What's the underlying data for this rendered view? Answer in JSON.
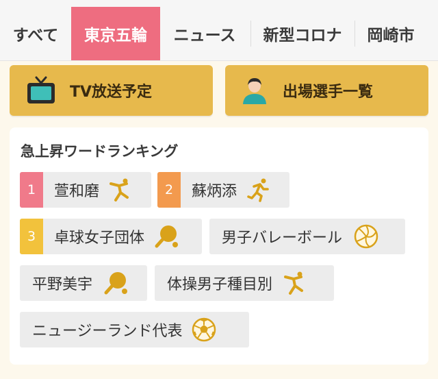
{
  "tabs": [
    {
      "label": "すべて",
      "active": false
    },
    {
      "label": "東京五輪",
      "active": true
    },
    {
      "label": "ニュース",
      "active": false
    },
    {
      "label": "新型コロナ",
      "active": false
    },
    {
      "label": "岡崎市",
      "active": false
    }
  ],
  "buttons": {
    "tv_label": "TV放送予定",
    "athletes_label": "出場選手一覧"
  },
  "ranking": {
    "title": "急上昇ワードランキング",
    "items": [
      {
        "rank": "1",
        "label": "萱和磨",
        "icon": "gymnastics-icon"
      },
      {
        "rank": "2",
        "label": "蘇炳添",
        "icon": "running-icon"
      },
      {
        "rank": "3",
        "label": "卓球女子団体",
        "icon": "table-tennis-icon"
      },
      {
        "rank": "",
        "label": "男子バレーボール",
        "icon": "volleyball-icon"
      },
      {
        "rank": "",
        "label": "平野美宇",
        "icon": "table-tennis-icon"
      },
      {
        "rank": "",
        "label": "体操男子種目別",
        "icon": "gymnastics-icon"
      },
      {
        "rank": "",
        "label": "ニュージーランド代表",
        "icon": "soccer-ball-icon"
      }
    ]
  },
  "colors": {
    "accent_tab": "#ee6d80",
    "button_bg": "#e7b94c",
    "rank1": "#f07a8a",
    "rank2": "#f39a4e",
    "rank3": "#f2c23c",
    "icon_gold": "#d9a21a"
  }
}
